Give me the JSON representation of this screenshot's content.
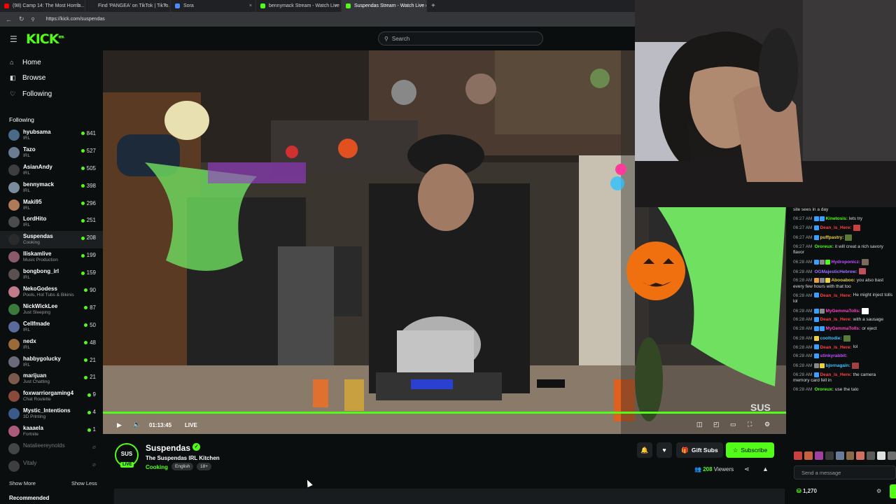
{
  "browser": {
    "tabs": [
      {
        "title": "(98) Camp 14: The Most Horrib...",
        "favicon_color": "#ff0000"
      },
      {
        "title": "Find 'PANGEA' on TikTok | TikTo...",
        "favicon_color": "#222222"
      },
      {
        "title": "Sora",
        "favicon_color": "#4a8cff"
      },
      {
        "title": "bennymack Stream - Watch Live o...",
        "favicon_color": "#53fc18"
      },
      {
        "title": "Suspendas Stream - Watch Live o...",
        "favicon_color": "#53fc18",
        "active": true
      }
    ],
    "url": "https://kick.com/suspendas"
  },
  "header": {
    "logo": "KICK",
    "logo_sup": "BETA",
    "search_placeholder": "Search"
  },
  "sidebar": {
    "nav": [
      {
        "label": "Home",
        "icon": "home-icon",
        "glyph": "⌂"
      },
      {
        "label": "Browse",
        "icon": "browse-icon",
        "glyph": "◧"
      },
      {
        "label": "Following",
        "icon": "heart-icon",
        "glyph": "♡"
      }
    ],
    "following_header": "Following",
    "following": [
      {
        "name": "hyubsama",
        "category": "IRL",
        "viewers": "841",
        "avatar": "#4a6a8a"
      },
      {
        "name": "Tazo",
        "category": "IRL",
        "viewers": "527",
        "avatar": "#6a7b92"
      },
      {
        "name": "AsianAndy",
        "category": "IRL",
        "viewers": "505",
        "avatar": "#3e3e3e"
      },
      {
        "name": "bennymack",
        "category": "IRL",
        "viewers": "398",
        "avatar": "#7a8c9c"
      },
      {
        "name": "Maki95",
        "category": "IRL",
        "viewers": "296",
        "avatar": "#b07a5a"
      },
      {
        "name": "LordHito",
        "category": "IRL",
        "viewers": "251",
        "avatar": "#4c4c4c"
      },
      {
        "name": "Suspendas",
        "category": "Cooking",
        "viewers": "208",
        "avatar": "#2a2a2a",
        "selected": true
      },
      {
        "name": "lliskamlive",
        "category": "Music Production",
        "viewers": "199",
        "avatar": "#8a5a6a"
      },
      {
        "name": "bongbong_irl",
        "category": "IRL",
        "viewers": "159",
        "avatar": "#5a5050"
      },
      {
        "name": "NekoGodess",
        "category": "Pools, Hot Tubs & Bikinis",
        "viewers": "90",
        "avatar": "#c07a8a"
      },
      {
        "name": "NickWickLee",
        "category": "Just Sleeping",
        "viewers": "87",
        "avatar": "#3a7a3a"
      },
      {
        "name": "Cellfmade",
        "category": "IRL",
        "viewers": "50",
        "avatar": "#5a6a9a"
      },
      {
        "name": "nedx",
        "category": "IRL",
        "viewers": "48",
        "avatar": "#9a6a3a"
      },
      {
        "name": "habbygolucky",
        "category": "IRL",
        "viewers": "21",
        "avatar": "#6a6a7a"
      },
      {
        "name": "marijuan",
        "category": "Just Chatting",
        "viewers": "21",
        "avatar": "#7a5a4a"
      },
      {
        "name": "foxwarriorgaming4",
        "category": "Chat Roulette",
        "viewers": "9",
        "avatar": "#8a4a3a"
      },
      {
        "name": "Mystic_Intentions",
        "category": "3D Printing",
        "viewers": "4",
        "avatar": "#3a5a8a"
      },
      {
        "name": "kaaaela",
        "category": "Fortnite",
        "viewers": "1",
        "avatar": "#aa5a7a"
      },
      {
        "name": "Natalieereynolds",
        "category": "",
        "viewers": "",
        "avatar": "#8a8a8a",
        "offline": true
      },
      {
        "name": "Vitaly",
        "category": "",
        "viewers": "",
        "avatar": "#7a7a7a",
        "offline": true
      }
    ],
    "show_more": "Show More",
    "show_less": "Show Less",
    "recommended_header": "Recommended"
  },
  "player": {
    "time": "01:13:45",
    "live_label": "LIVE",
    "progress_fraction": 1.0
  },
  "channel": {
    "name": "Suspendas",
    "avatar_text": "SUS",
    "live_badge": "LIVE",
    "stream_title": "The Suspendas IRL Kitchen",
    "category": "Cooking",
    "tags": [
      "English",
      "18+"
    ],
    "gift_label": "Gift Subs",
    "subscribe_label": "Subscribe",
    "viewers_count": "208",
    "viewers_label": "Viewers"
  },
  "chat": {
    "top_fragment": "site sees in a day",
    "messages": [
      {
        "time": "06:27 AM",
        "user": "Kinetosis:",
        "text": "lets try",
        "color": "#53fc18",
        "badges": [
          "#3aa0ff",
          "#3aa0ff"
        ]
      },
      {
        "time": "06:27 AM",
        "user": "Dean_is_Here:",
        "text": "",
        "color": "#ff4040",
        "badges": [
          "#3aa0ff"
        ],
        "emote": "#c84040"
      },
      {
        "time": "06:27 AM",
        "user": "puffpastry:",
        "text": "",
        "color": "#e8d040",
        "badges": [
          "#3aa0ff"
        ],
        "emote": "#5a7a3a"
      },
      {
        "time": "06:27 AM",
        "user": "Ororeux:",
        "text": "it will creat a rich savory flavor",
        "color": "#53fc18",
        "badges": []
      },
      {
        "time": "06:28 AM",
        "user": "Hydroponicz:",
        "text": "",
        "color": "#c050ff",
        "badges": [
          "#3aa0ff",
          "#888",
          "#53fc18"
        ],
        "emote": "#7a6a5a"
      },
      {
        "time": "06:28 AM",
        "user": "OGMajesticHebrew:",
        "text": "",
        "color": "#a070ff",
        "badges": [],
        "emote": "#c05060"
      },
      {
        "time": "06:28 AM",
        "user": "Abooaboo:",
        "text": "you also bast every few hours with that too",
        "color": "#e8d040",
        "badges": [
          "#e8a040",
          "#888",
          "#e8d040"
        ]
      },
      {
        "time": "06:28 AM",
        "user": "Dean_is_Here:",
        "text": "He might inject tolls lol",
        "color": "#ff4040",
        "badges": [
          "#3aa0ff"
        ]
      },
      {
        "time": "06:28 AM",
        "user": "MyGemmaTolls:",
        "text": "",
        "color": "#ff40c0",
        "badges": [
          "#3aa0ff",
          "#888"
        ],
        "emote": "#ffffff"
      },
      {
        "time": "06:28 AM",
        "user": "Dean_is_Here:",
        "text": "with a sausage",
        "color": "#ff4040",
        "badges": [
          "#3aa0ff"
        ]
      },
      {
        "time": "06:28 AM",
        "user": "MyGemmaTolls:",
        "text": "or eject",
        "color": "#ff40c0",
        "badges": [
          "#3aa0ff",
          "#3aa0ff"
        ]
      },
      {
        "time": "06:28 AM",
        "user": "cooltodie:",
        "text": "",
        "color": "#40c0ff",
        "badges": [
          "#e8d040"
        ],
        "emote": "#5a7a3a"
      },
      {
        "time": "06:28 AM",
        "user": "Dean_is_Here:",
        "text": "lol",
        "color": "#ff4040",
        "badges": [
          "#3aa0ff"
        ]
      },
      {
        "time": "06:28 AM",
        "user": "stinkyrabbit:",
        "text": "",
        "color": "#c050ff",
        "badges": [
          "#3aa0ff"
        ],
        "emote": ""
      },
      {
        "time": "06:28 AM",
        "user": "bjornagain:",
        "text": "",
        "color": "#40c0ff",
        "badges": [
          "#888",
          "#e8d040"
        ],
        "emote": "#a04040"
      },
      {
        "time": "06:28 AM",
        "user": "Dean_is_Here:",
        "text": "the camera memory card fell in",
        "color": "#ff4040",
        "badges": [
          "#3aa0ff"
        ]
      },
      {
        "time": "06:28 AM",
        "user": "Ororeux:",
        "text": "use the talo",
        "color": "#53fc18",
        "badges": []
      }
    ],
    "emotes": [
      "#c84040",
      "#c86040",
      "#a040a0",
      "#3a3a3a",
      "#6a7a9a",
      "#8a6a4a",
      "#d07060",
      "#5a5a5a",
      "#e0e0e0",
      "#707070"
    ],
    "input_placeholder": "Send a message",
    "points": "1,270"
  }
}
